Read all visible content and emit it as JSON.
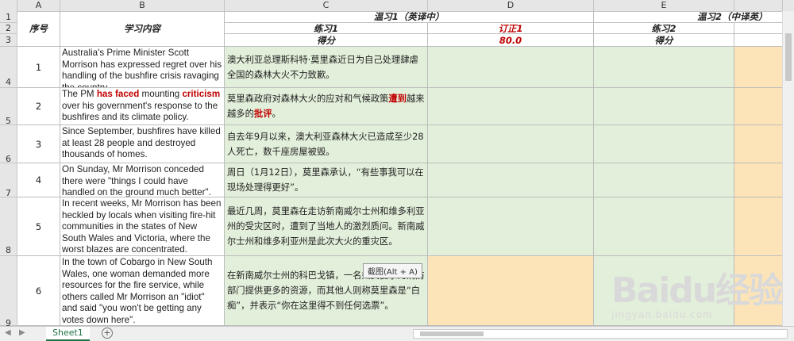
{
  "columns": [
    "A",
    "B",
    "C",
    "D",
    "E"
  ],
  "row_numbers": [
    "1",
    "2",
    "3",
    "4",
    "5",
    "6",
    "7",
    "8",
    "9"
  ],
  "header": {
    "seq_label": "序号",
    "content_label": "学习内容",
    "group1_title": "温习1（英译中）",
    "group2_title": "温习2（中译英）",
    "practice1": "练习1",
    "correction1": "订正1",
    "score_label": "得分",
    "score_value": "80.0",
    "practice2": "练习2",
    "score2_label": "得分"
  },
  "rows": [
    {
      "num": "1",
      "en": "Australia's Prime Minister Scott Morrison has expressed regret over his handling of the bushfire crisis ravaging the country.",
      "zh": "澳大利亚总理斯科特·莫里森近日为自己处理肆虐全国的森林大火不力致歉。"
    },
    {
      "num": "2",
      "en_parts": [
        "The PM ",
        "has faced",
        " mounting ",
        "criticism",
        " over his government's response to the bushfires and its climate policy."
      ],
      "zh_parts": [
        "莫里森政府对森林大火的应对和气候政策",
        "遭到",
        "越来越多的",
        "批评",
        "。"
      ]
    },
    {
      "num": "3",
      "en": "Since September, bushfires have killed at least 28 people and destroyed thousands of homes.",
      "zh": "自去年9月以来，澳大利亚森林大火已造成至少28人死亡，数千座房屋被毁。"
    },
    {
      "num": "4",
      "en": "On Sunday, Mr Morrison conceded there were \"things I could have handled on the ground much better\".",
      "zh": "周日（1月12日），莫里森承认，“有些事我可以在现场处理得更好”。"
    },
    {
      "num": "5",
      "en": "In recent weeks, Mr Morrison has been heckled by locals when visiting fire-hit communities in the states of New South Wales and Victoria, where the worst blazes are concentrated.",
      "zh": "最近几周，莫里森在走访新南威尔士州和维多利亚州的受灾区时，遭到了当地人的激烈质问。新南威尔士州和维多利亚州是此次大火的重灾区。"
    },
    {
      "num": "6",
      "en": "In the town of Cobargo in New South Wales, one woman demanded more resources for the fire service, while others called Mr Morrison an \"idiot\" and said \"you won't be getting any votes down here\".",
      "zh": "在新南威尔士州的科巴戈镇，一名妇女要求为消防部门提供更多的资源，而其他人则称莫里森是“白痴”，并表示“你在这里得不到任何选票”。"
    }
  ],
  "tooltip": "截图(Alt + A)",
  "sheet_tab": "Sheet1",
  "add_sheet": "+",
  "watermark": {
    "brand": "Baidu经验",
    "url": "jingyan.baidu.com"
  },
  "colors": {
    "green": "#e2efda",
    "orange": "#fce4b8",
    "red": "#c00000",
    "tab": "#217346"
  }
}
